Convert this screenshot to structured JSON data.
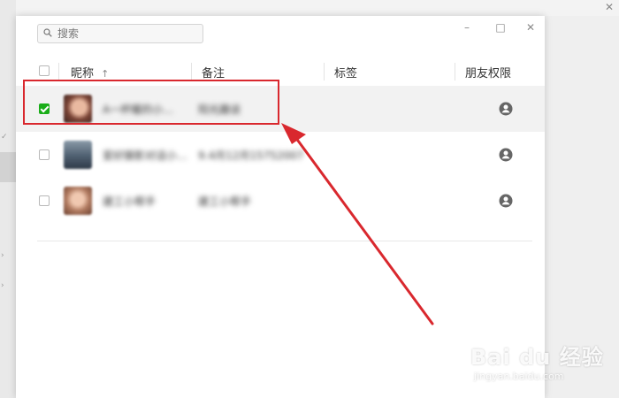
{
  "window": {
    "controls": {
      "minimize": "–",
      "maximize": "□",
      "close": "✕"
    },
    "background_close": "✕"
  },
  "search": {
    "placeholder": "搜索",
    "value": ""
  },
  "table": {
    "columns": [
      {
        "label": "昵称",
        "sort_indicator": "↑"
      },
      {
        "label": "备注"
      },
      {
        "label": "标签"
      },
      {
        "label": "朋友权限"
      }
    ],
    "rows": [
      {
        "checked": true,
        "selected": true,
        "nickname": "A一杯暖的小…",
        "remark": "阳光趣谈"
      },
      {
        "checked": false,
        "selected": false,
        "nickname": "爱好摄影对话小…",
        "remark": "9.4月12月15752007"
      },
      {
        "checked": false,
        "selected": false,
        "nickname": "建工小帮手",
        "remark": "建工小帮手"
      }
    ]
  },
  "sidebar": {
    "glyphs": [
      "✓",
      "›",
      "›"
    ]
  },
  "colors": {
    "accent_green": "#1aad19",
    "annotation_red": "#d9282e",
    "selected_row": "#f2f2f2"
  },
  "watermark": {
    "main": "Bai du 经验",
    "sub": "jingyan.baidu.com"
  }
}
